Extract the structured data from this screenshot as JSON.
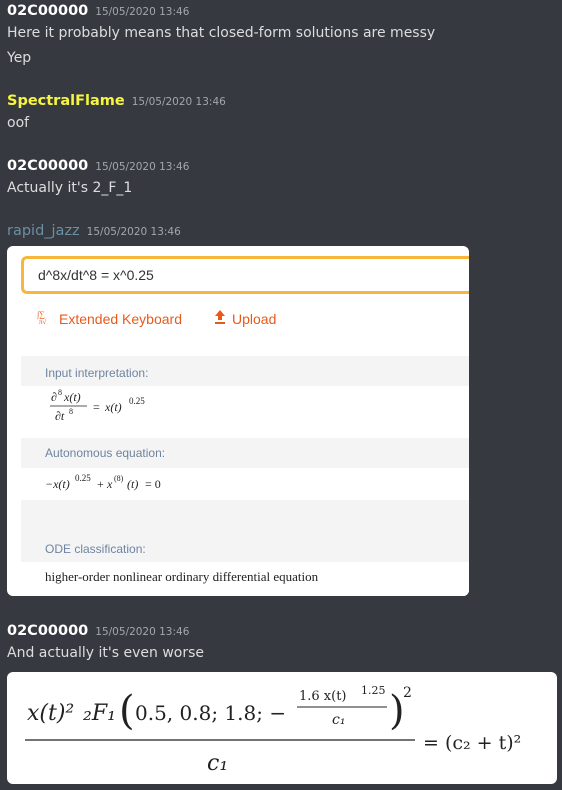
{
  "messages": [
    {
      "user": "02C00000",
      "user_color": "#ffffff",
      "time": "15/05/2020 13:46",
      "lines": [
        "Here it probably means that closed-form solutions are messy",
        "Yep"
      ]
    },
    {
      "user": "SpectralFlame",
      "user_color": "#f5f542",
      "time": "15/05/2020 13:46",
      "lines": [
        "oof"
      ]
    },
    {
      "user": "02C00000",
      "user_color": "#ffffff",
      "time": "15/05/2020 13:46",
      "lines": [
        "Actually it's 2_F_1"
      ]
    },
    {
      "user": "rapid_jazz",
      "user_color": "#6b8fa3",
      "time": "15/05/2020 13:46",
      "lines": []
    },
    {
      "user": "02C00000",
      "user_color": "#ffffff",
      "time": "15/05/2020 13:46",
      "lines": [
        "And actually it's even worse"
      ]
    }
  ],
  "wolfram": {
    "input": "d^8x/dt^8 = x^0.25",
    "extended_keyboard": "Extended Keyboard",
    "upload": "Upload",
    "pods": {
      "input_interpretation": "Input interpretation:",
      "autonomous_equation": "Autonomous equation:",
      "ode_classification": "ODE classification:",
      "classification_value": "higher-order nonlinear ordinary differential equation"
    },
    "accent": "#e85a1a",
    "input_border": "#f6b73c"
  },
  "formula": {
    "numerator_lhs": "x(t)²",
    "hypergeo": "₂F₁",
    "args": "0.5, 0.8; 1.8; −",
    "inner_num": "1.6 x(t)",
    "inner_exp": "1.25",
    "inner_den": "c₁",
    "outer_exp": "2",
    "denominator": "c₁",
    "rhs": "= (c₂ + t)²"
  }
}
